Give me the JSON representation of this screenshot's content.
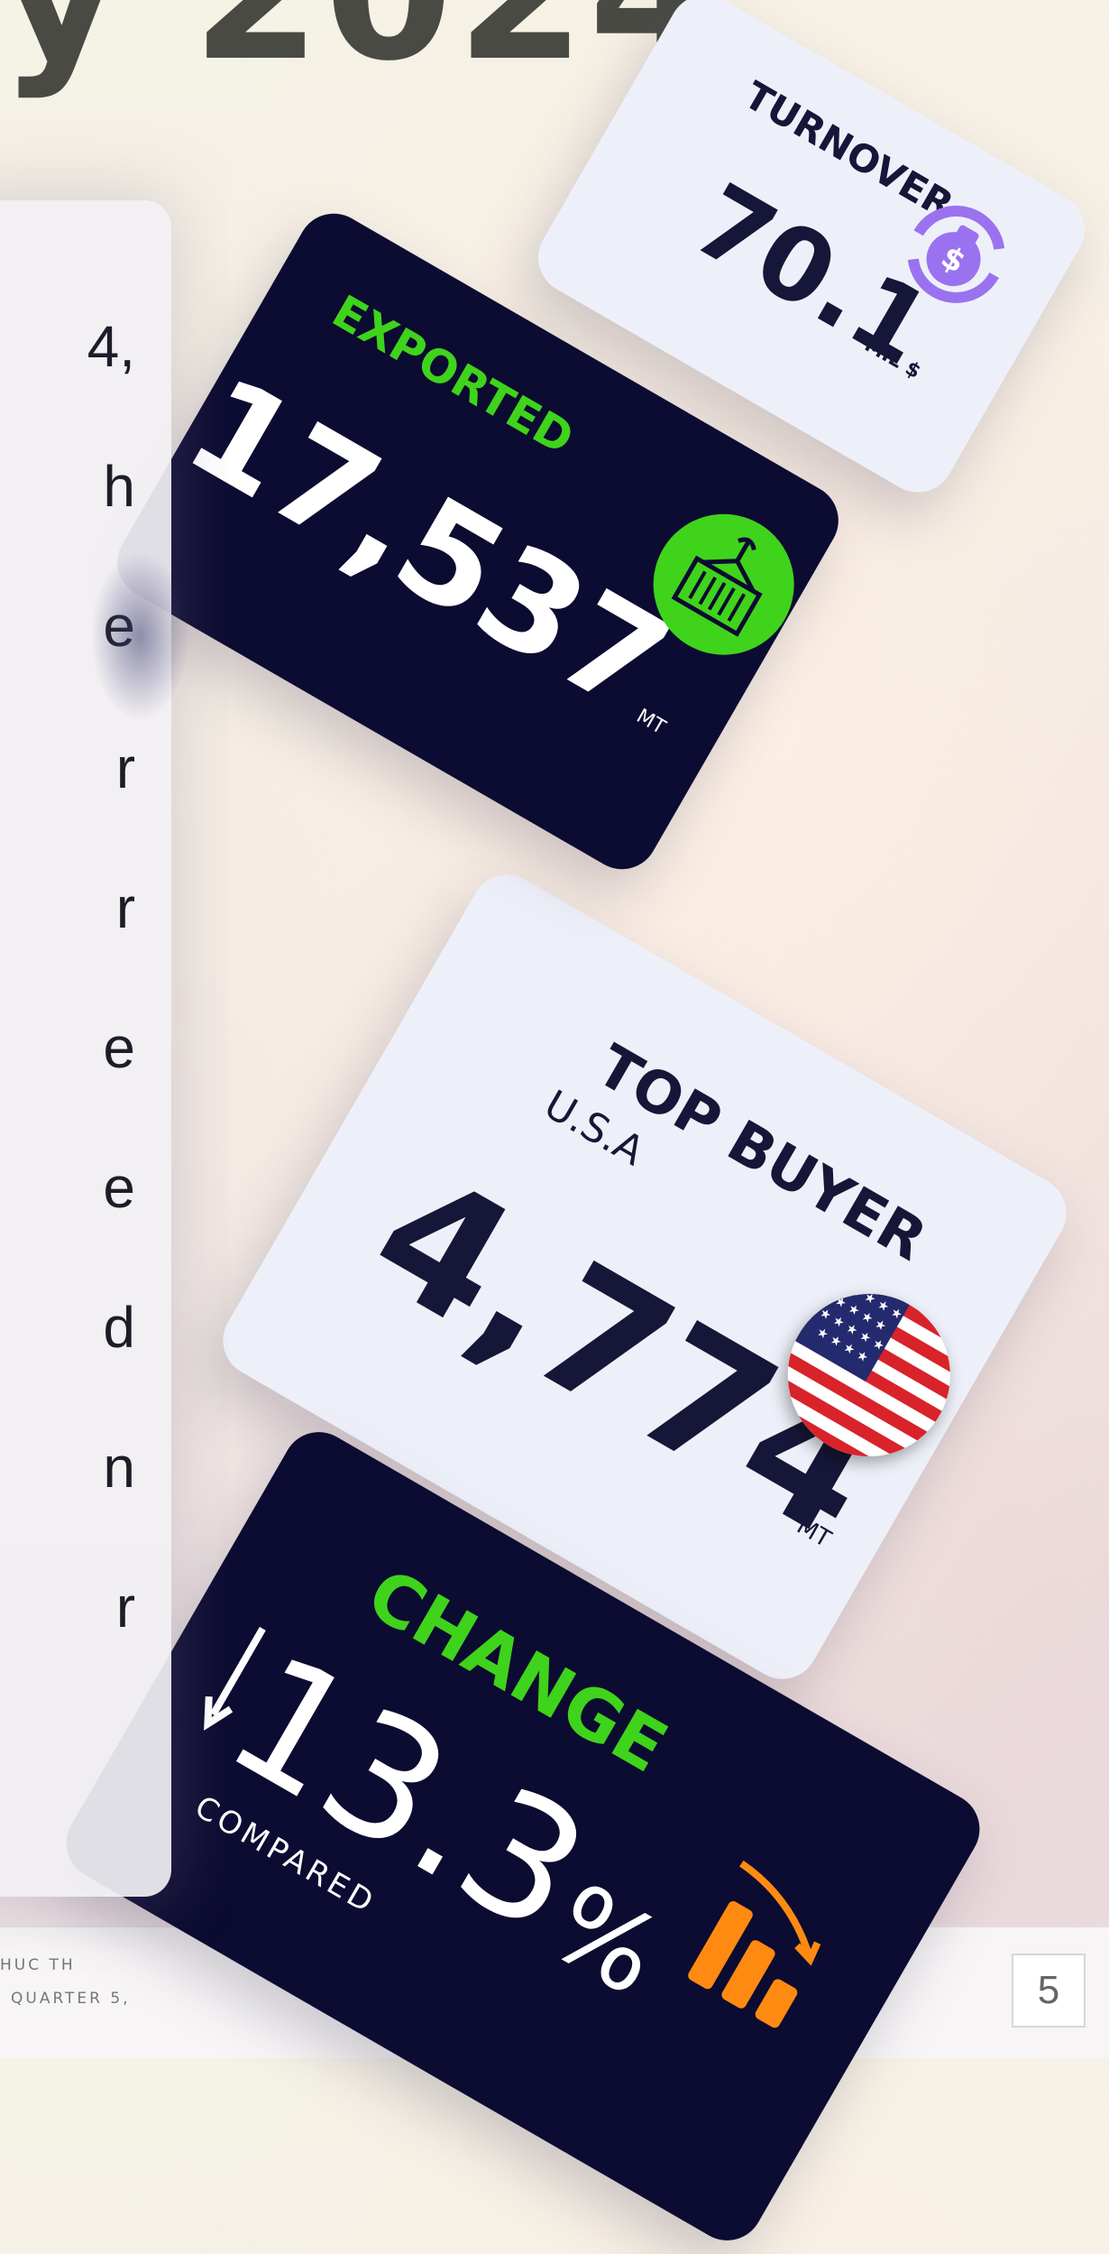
{
  "heading": "y 2024",
  "body_line_endings": [
    "4,",
    "h",
    "e",
    "r",
    "r",
    "e",
    "e",
    "d",
    "n",
    "r"
  ],
  "cards": {
    "turnover": {
      "label": "TURNOVER",
      "value": "70.1",
      "unit": "MIL $"
    },
    "exported": {
      "label": "EXPORTED",
      "value": "17,537",
      "unit": "MT"
    },
    "top_buyer": {
      "label": "TOP BUYER",
      "country": "U.S.A",
      "value": "4,774",
      "unit": "MT"
    },
    "change": {
      "label": "CHANGE",
      "value": "13.3",
      "percent_sign": "%",
      "note": "COMPARED"
    }
  },
  "footer": {
    "line1": "HUC TH",
    "line2": "QUARTER 5,",
    "page_number": "5"
  },
  "colors": {
    "accent_green": "#3fd31c",
    "navy": "#0c0b31",
    "purple": "#9a72f0",
    "orange": "#ff8a12"
  },
  "icons": {
    "turnover": "money-bag-cycle-icon",
    "exported": "cargo-container-icon",
    "top_buyer": "usa-flag-icon",
    "change": "decreasing-bars-icon"
  }
}
